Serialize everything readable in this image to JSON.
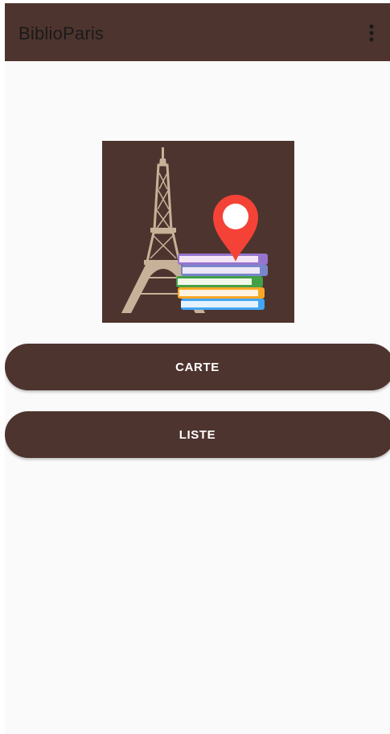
{
  "app_bar": {
    "title": "BiblioParis",
    "overflow_icon": "more-vertical-icon",
    "background_color": "#4e342e"
  },
  "logo": {
    "icons": [
      "eiffel-tower-icon",
      "map-pin-icon",
      "books-stack-icon"
    ],
    "pin_color": "#f44336"
  },
  "buttons": {
    "carte_label": "CARTE",
    "liste_label": "LISTE"
  },
  "colors": {
    "primary": "#4e342e",
    "background": "#fafafa",
    "button_text": "#ffffff"
  }
}
